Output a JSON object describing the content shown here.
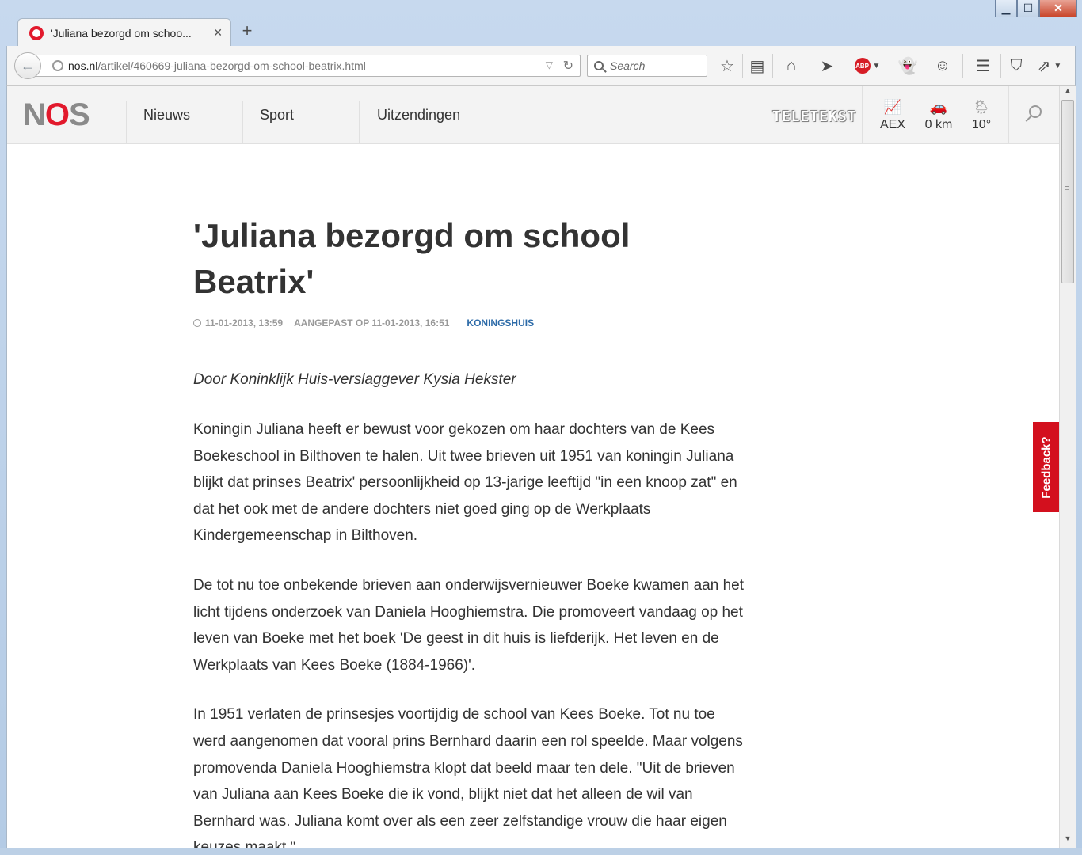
{
  "browser": {
    "tab_title": "'Juliana bezorgd om schoo...",
    "tab_close": "✕",
    "new_tab": "+",
    "url_host": "nos.nl",
    "url_path": "/artikel/460669-juliana-bezorgd-om-school-beatrix.html",
    "search_placeholder": "Search",
    "abp_label": "ABP"
  },
  "site": {
    "logo_left": "N",
    "logo_o": "O",
    "logo_right": "S",
    "nav": [
      "Nieuws",
      "Sport",
      "Uitzendingen"
    ],
    "teletekst": "TELETEKST",
    "widgets": [
      {
        "icon": "chart-icon",
        "label": "AEX"
      },
      {
        "icon": "car-icon",
        "label": "0 km"
      },
      {
        "icon": "weather-icon",
        "label": "10°"
      }
    ],
    "feedback": "Feedback?"
  },
  "article": {
    "headline": "'Juliana bezorgd om school Beatrix'",
    "published": "11-01-2013, 13:59",
    "updated": "AANGEPAST OP 11-01-2013, 16:51",
    "topic": "KONINGSHUIS",
    "byline": "Door Koninklijk Huis-verslaggever Kysia Hekster",
    "paragraphs": [
      "Koningin Juliana heeft er bewust voor gekozen om haar dochters van de Kees Boekeschool in Bilthoven te halen. Uit twee brieven uit 1951 van koningin Juliana blijkt dat prinses Beatrix' persoonlijkheid op 13-jarige leeftijd \"in een knoop zat\" en dat het ook met de andere dochters niet goed ging op de Werkplaats Kindergemeenschap in Bilthoven.",
      "De tot nu toe onbekende brieven aan onderwijsvernieuwer Boeke kwamen aan het licht tijdens onderzoek van Daniela Hooghiemstra. Die promoveert vandaag op het leven van Boeke met het boek 'De geest in dit huis is liefderijk. Het leven en de Werkplaats van Kees Boeke (1884-1966)'.",
      "In 1951 verlaten de prinsesjes voortijdig de school van Kees Boeke. Tot nu toe werd aangenomen dat vooral prins Bernhard daarin een rol speelde. Maar volgens promovenda Daniela Hooghiemstra klopt dat beeld maar ten dele. \"Uit de brieven van Juliana aan Kees Boeke die ik vond, blijkt niet dat het alleen de wil van Bernhard was. Juliana komt over als een zeer zelfstandige vrouw die haar eigen keuzes maakt.\""
    ]
  },
  "colors": {
    "nos_red": "#e2192c",
    "topic_blue": "#2d6ba8",
    "feedback_red": "#d3101e"
  }
}
